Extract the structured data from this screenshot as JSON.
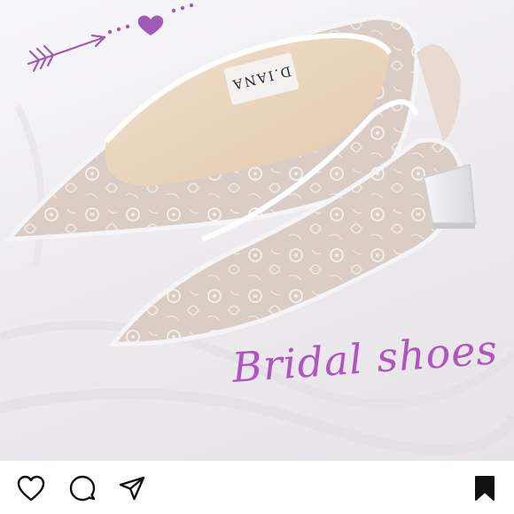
{
  "post": {
    "caption": "Bridal shoes",
    "brand_label": "D.IANA",
    "decoration": [
      "heart-icon",
      "dotted-trail",
      "arrow-icon"
    ],
    "accent_color": "#b054c0"
  },
  "action_bar": {
    "like_icon": "heart-outline-icon",
    "comment_icon": "speech-bubble-icon",
    "share_icon": "paper-plane-icon",
    "save_icon": "bookmark-filled-icon",
    "icon_color": "#111111"
  }
}
